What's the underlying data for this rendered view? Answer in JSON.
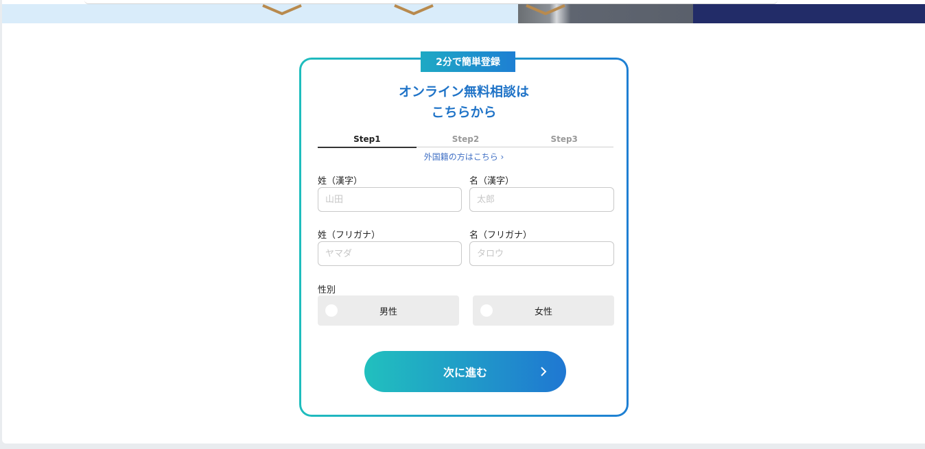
{
  "form": {
    "badge": "2分で簡単登録",
    "title_line1": "オンライン無料相談は",
    "title_line2": "こちらから",
    "steps": [
      {
        "label": "Step1",
        "active": true
      },
      {
        "label": "Step2",
        "active": false
      },
      {
        "label": "Step3",
        "active": false
      }
    ],
    "foreign_link": "外国籍の方はこちら ›",
    "last_name_kanji": {
      "label": "姓（漢字）",
      "placeholder": "山田",
      "value": ""
    },
    "first_name_kanji": {
      "label": "名（漢字）",
      "placeholder": "太郎",
      "value": ""
    },
    "last_name_kana": {
      "label": "姓（フリガナ）",
      "placeholder": "ヤマダ",
      "value": ""
    },
    "first_name_kana": {
      "label": "名（フリガナ）",
      "placeholder": "タロウ",
      "value": ""
    },
    "gender": {
      "label": "性別",
      "options": [
        "男性",
        "女性"
      ]
    },
    "next_button": "次に進む"
  },
  "colors": {
    "accent_start": "#1fbdbd",
    "accent_end": "#1e7fd3",
    "title": "#1f73c7",
    "link": "#3f6fc4",
    "banner_navy": "#222c68",
    "banner_light": "#d9ecfa"
  },
  "icons": {
    "next_arrow": "chevron-right-icon",
    "banner_marks": "chevron-down-icon"
  }
}
